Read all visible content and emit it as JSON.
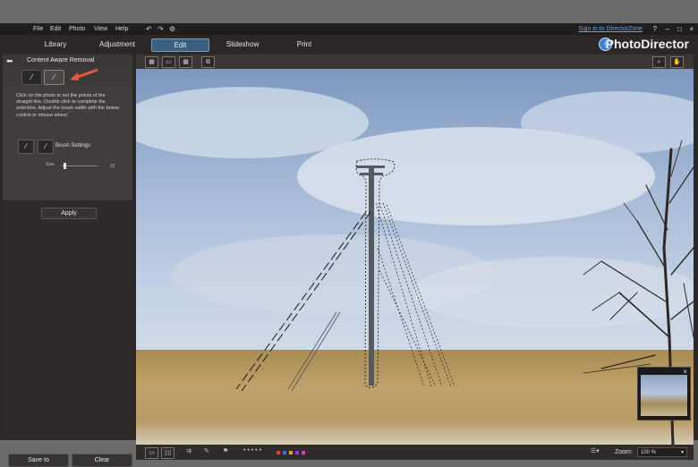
{
  "menu": [
    "File",
    "Edit",
    "Photo",
    "View",
    "Help"
  ],
  "signin": "Sign in to DirectorZone",
  "window_buttons": [
    "?",
    "–",
    "□",
    "×"
  ],
  "tabs": [
    "Library",
    "Adjustment",
    "Edit",
    "Slideshow",
    "Print"
  ],
  "active_tab": "Edit",
  "brand": "PhotoDirector",
  "panel": {
    "title": "Content Aware Removal",
    "instructions": "Click on the photo to set the points of the straight line. Double click to complete the selection. Adjust the brush width with the below control or mouse wheel",
    "brush_label": "Brush Settings",
    "size_label": "Size",
    "size_value": "12",
    "apply": "Apply",
    "save_to": "Save to",
    "clear": "Clear"
  },
  "bottom": {
    "zoom_label": "Zoom:",
    "zoom_value": "100 %",
    "dots": "• • • • •",
    "swatches": [
      "#e23b3b",
      "#3b6be2",
      "#e2a23b",
      "#8e3be2",
      "#d83bd8"
    ]
  },
  "colors": {
    "accent": "#3b5f80",
    "arrow": "#e85a3a"
  },
  "icons": [
    "undo-icon",
    "redo-icon",
    "settings-icon",
    "brush-icon",
    "line-brush-icon",
    "zoom-icon",
    "hand-icon"
  ]
}
